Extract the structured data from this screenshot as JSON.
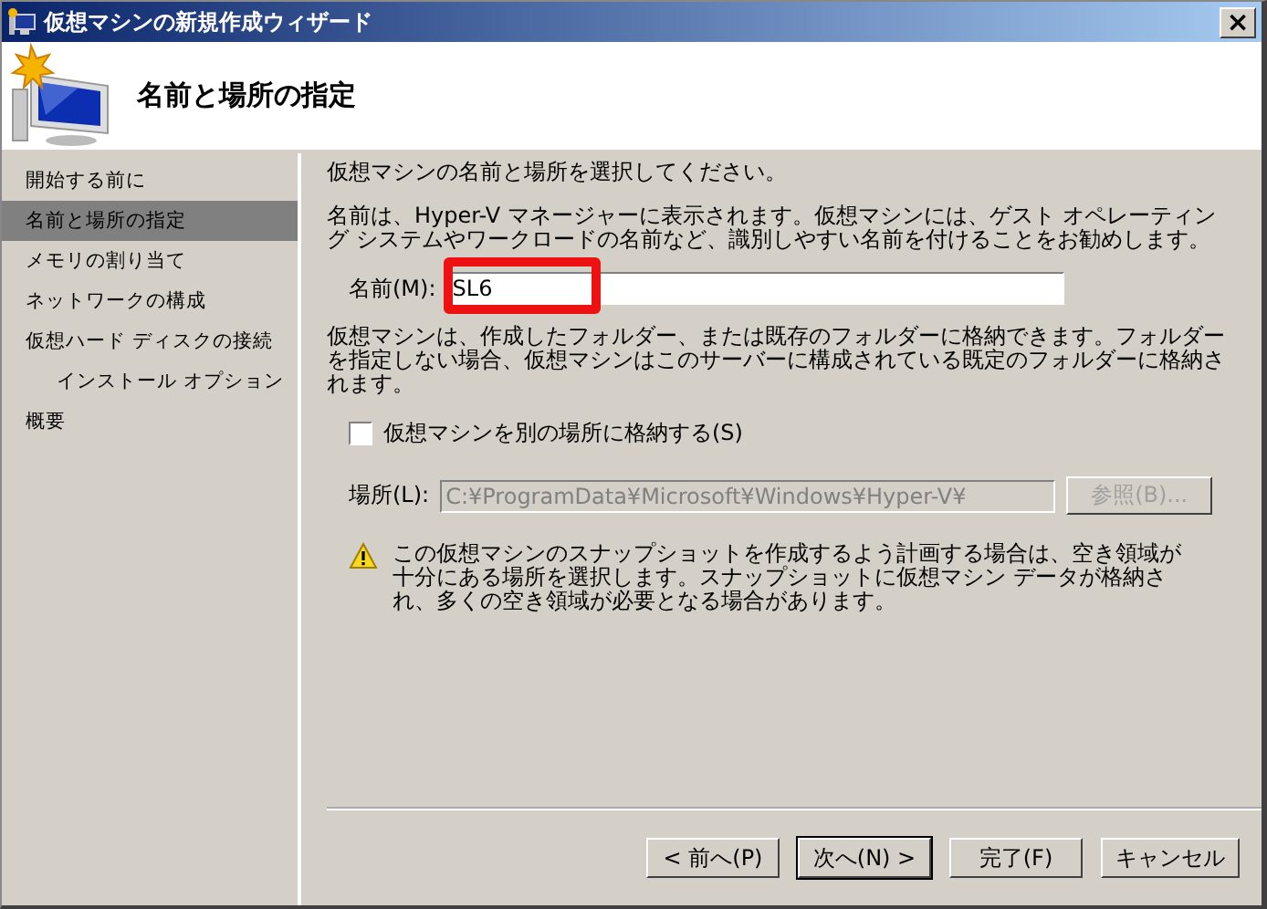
{
  "window": {
    "title": "仮想マシンの新規作成ウィザード",
    "close": "×"
  },
  "header": {
    "title": "名前と場所の指定"
  },
  "sidebar": {
    "items": [
      {
        "label": "開始する前に",
        "selected": false
      },
      {
        "label": "名前と場所の指定",
        "selected": true
      },
      {
        "label": "メモリの割り当て",
        "selected": false
      },
      {
        "label": "ネットワークの構成",
        "selected": false
      },
      {
        "label": "仮想ハード ディスクの接続",
        "selected": false,
        "children": [
          {
            "label": "インストール オプション",
            "selected": false
          }
        ]
      },
      {
        "label": "概要",
        "selected": false
      }
    ]
  },
  "content": {
    "intro": "仮想マシンの名前と場所を選択してください。",
    "description": "名前は、Hyper-V マネージャーに表示されます。仮想マシンには、ゲスト オペレーティング システムやワークロードの名前など、識別しやすい名前を付けることをお勧めします。",
    "name_field": {
      "label": "名前(M):",
      "value": "SL6",
      "highlighted": true
    },
    "folder_info": "仮想マシンは、作成したフォルダー、または既存のフォルダーに格納できます。フォルダーを指定しない場合、仮想マシンはこのサーバーに構成されている既定のフォルダーに格納されます。",
    "store_elsewhere": {
      "label": "仮想マシンを別の場所に格納する(S)",
      "checked": false
    },
    "location": {
      "label": "場所(L):",
      "value": "C:¥ProgramData¥Microsoft¥Windows¥Hyper-V¥",
      "disabled": true,
      "browse": "参照(B)..."
    },
    "warning": "この仮想マシンのスナップショットを作成するよう計画する場合は、空き領域が十分にある場所を選択します。スナップショットに仮想マシン データが格納され、多くの空き領域が必要となる場合があります。"
  },
  "buttons": [
    {
      "label": "< 前へ(P)",
      "default": false
    },
    {
      "label": "次へ(N) >",
      "default": true
    },
    {
      "label": "完了(F)",
      "default": false
    },
    {
      "label": "キャンセル",
      "default": false
    }
  ]
}
